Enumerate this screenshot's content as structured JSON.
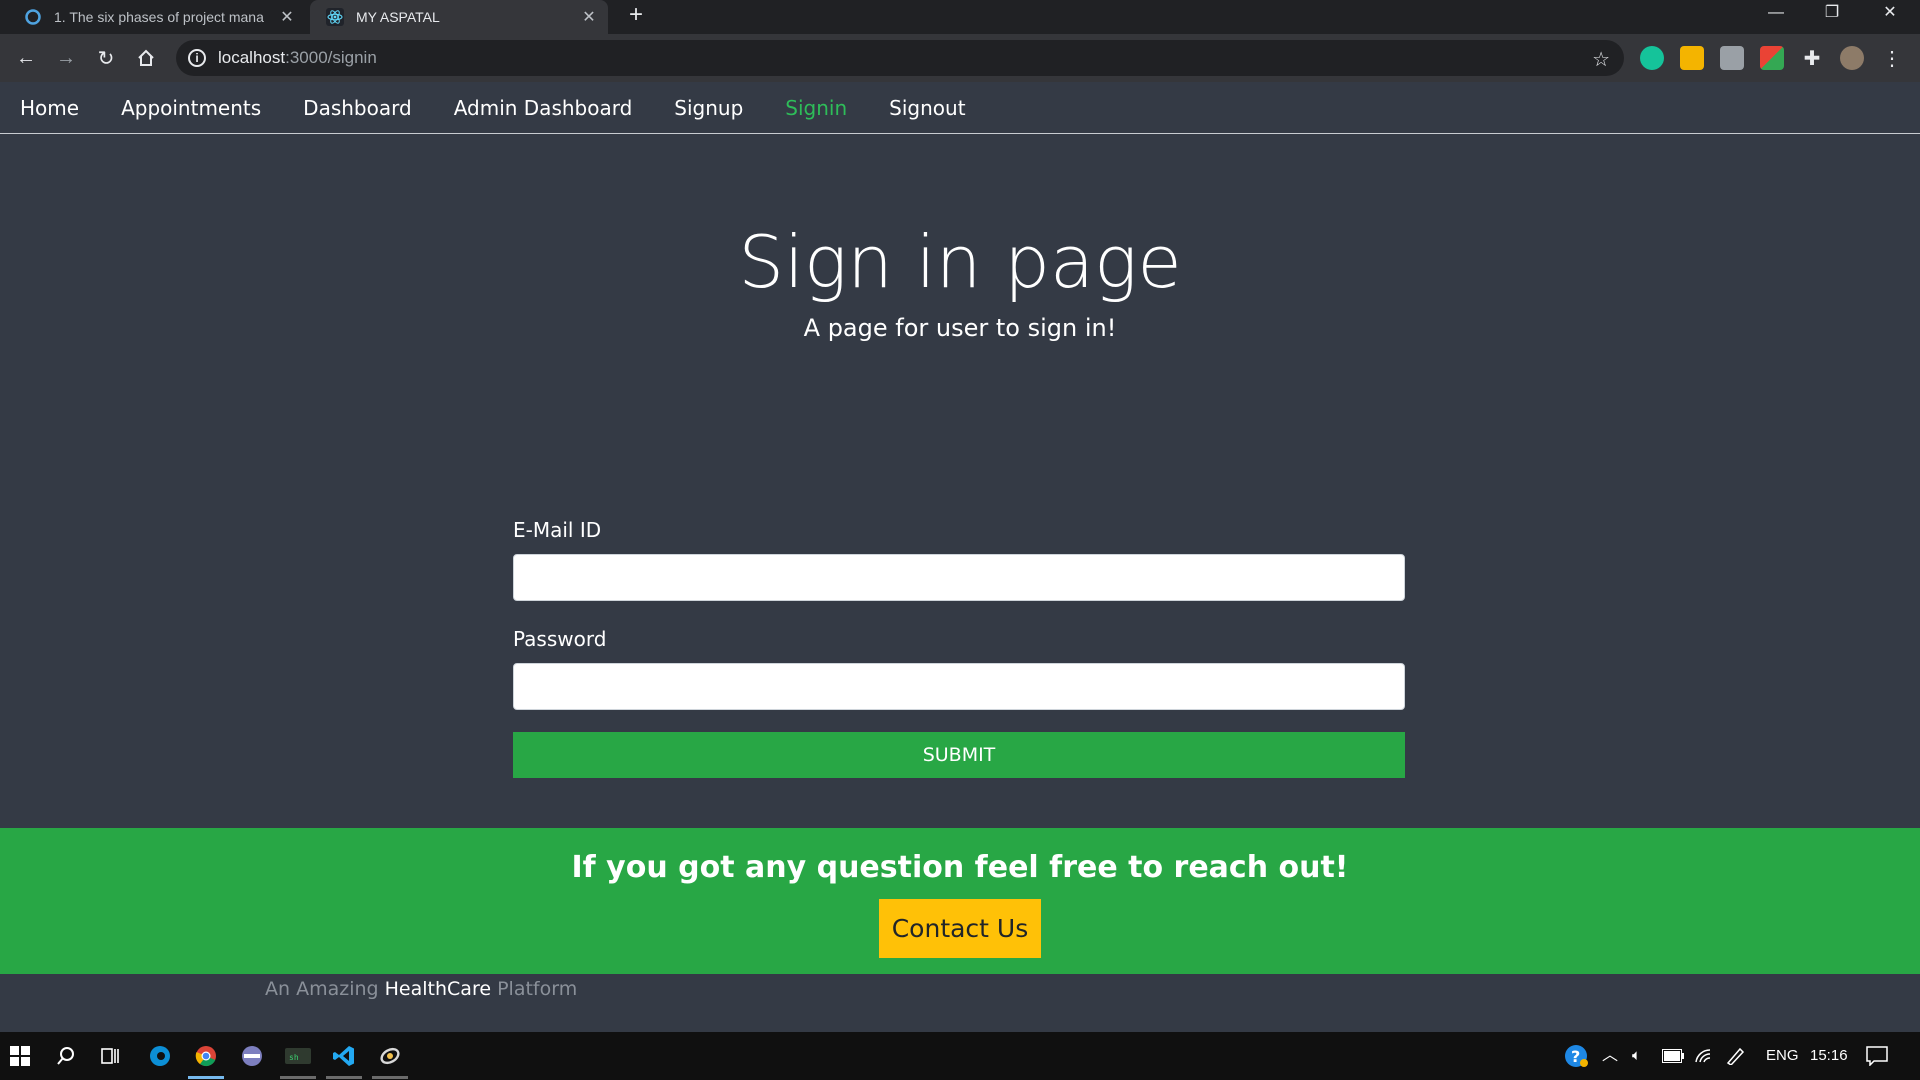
{
  "browser": {
    "tabs": [
      {
        "title": "1. The six phases of project mana",
        "active": false,
        "icon": "coursera-icon"
      },
      {
        "title": "MY ASPATAL",
        "active": true,
        "icon": "react-icon"
      }
    ],
    "address": {
      "host": "localhost",
      "path": ":3000/signin"
    }
  },
  "nav": {
    "items": [
      {
        "label": "Home",
        "active": false
      },
      {
        "label": "Appointments",
        "active": false
      },
      {
        "label": "Dashboard",
        "active": false
      },
      {
        "label": "Admin Dashboard",
        "active": false
      },
      {
        "label": "Signup",
        "active": false
      },
      {
        "label": "Signin",
        "active": true
      },
      {
        "label": "Signout",
        "active": false
      }
    ],
    "active_color": "#2ebd59"
  },
  "hero": {
    "title": "Sign in page",
    "subtitle": "A page for user to sign in!"
  },
  "form": {
    "email_label": "E-Mail ID",
    "email_value": "",
    "password_label": "Password",
    "password_value": "",
    "submit_label": "SUBMIT"
  },
  "footer": {
    "cta_text": "If you got any question feel free to reach out!",
    "contact_label": "Contact Us",
    "tagline_pre": "An Amazing",
    "tagline_strong": "HealthCare",
    "tagline_post": "Platform"
  },
  "taskbar": {
    "lang": "ENG",
    "time": "15:16"
  },
  "colors": {
    "page_bg": "#343a45",
    "green": "#28a745",
    "yellow": "#ffc107"
  }
}
